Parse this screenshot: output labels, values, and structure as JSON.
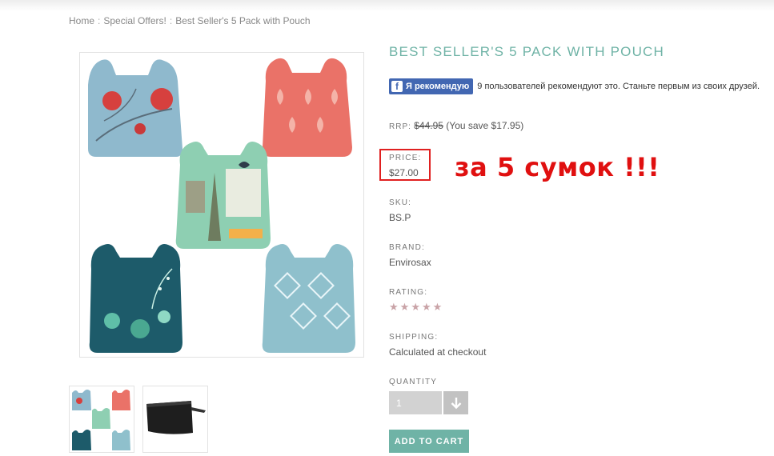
{
  "breadcrumb": {
    "home": "Home",
    "category": "Special Offers!",
    "current": "Best Seller's 5 Pack with Pouch",
    "sep": ":"
  },
  "product": {
    "title": "BEST SELLER'S 5 PACK WITH POUCH",
    "facebook": {
      "button_label": "Я рекомендую",
      "logo": "f",
      "text": "9 пользователей рекомендуют это. Станьте первым из своих друзей."
    },
    "rrp": {
      "label": "RRP:",
      "old_price": "$44.95",
      "savings": "(You save $17.95)"
    },
    "price": {
      "label": "PRICE:",
      "value": "$27.00"
    },
    "annotation": "за 5 сумок !!!",
    "sku": {
      "label": "SKU:",
      "value": "BS.P"
    },
    "brand": {
      "label": "BRAND:",
      "value": "Envirosax"
    },
    "rating": {
      "label": "RATING:",
      "value": 5,
      "max": 5
    },
    "shipping": {
      "label": "SHIPPING:",
      "value": "Calculated at checkout"
    },
    "quantity": {
      "label": "QUANTITY",
      "value": "1"
    },
    "add_to_cart": "ADD TO CART"
  },
  "images": {
    "main": {
      "icon": "five-bags-product-image"
    },
    "thumbnails": [
      {
        "icon": "five-bags-thumbnail"
      },
      {
        "icon": "black-pouch-thumbnail"
      }
    ]
  },
  "colors": {
    "accent": "#6fb3a6",
    "annotation": "#e01010",
    "facebook": "#4267b2",
    "star": "#c9a3a7"
  }
}
